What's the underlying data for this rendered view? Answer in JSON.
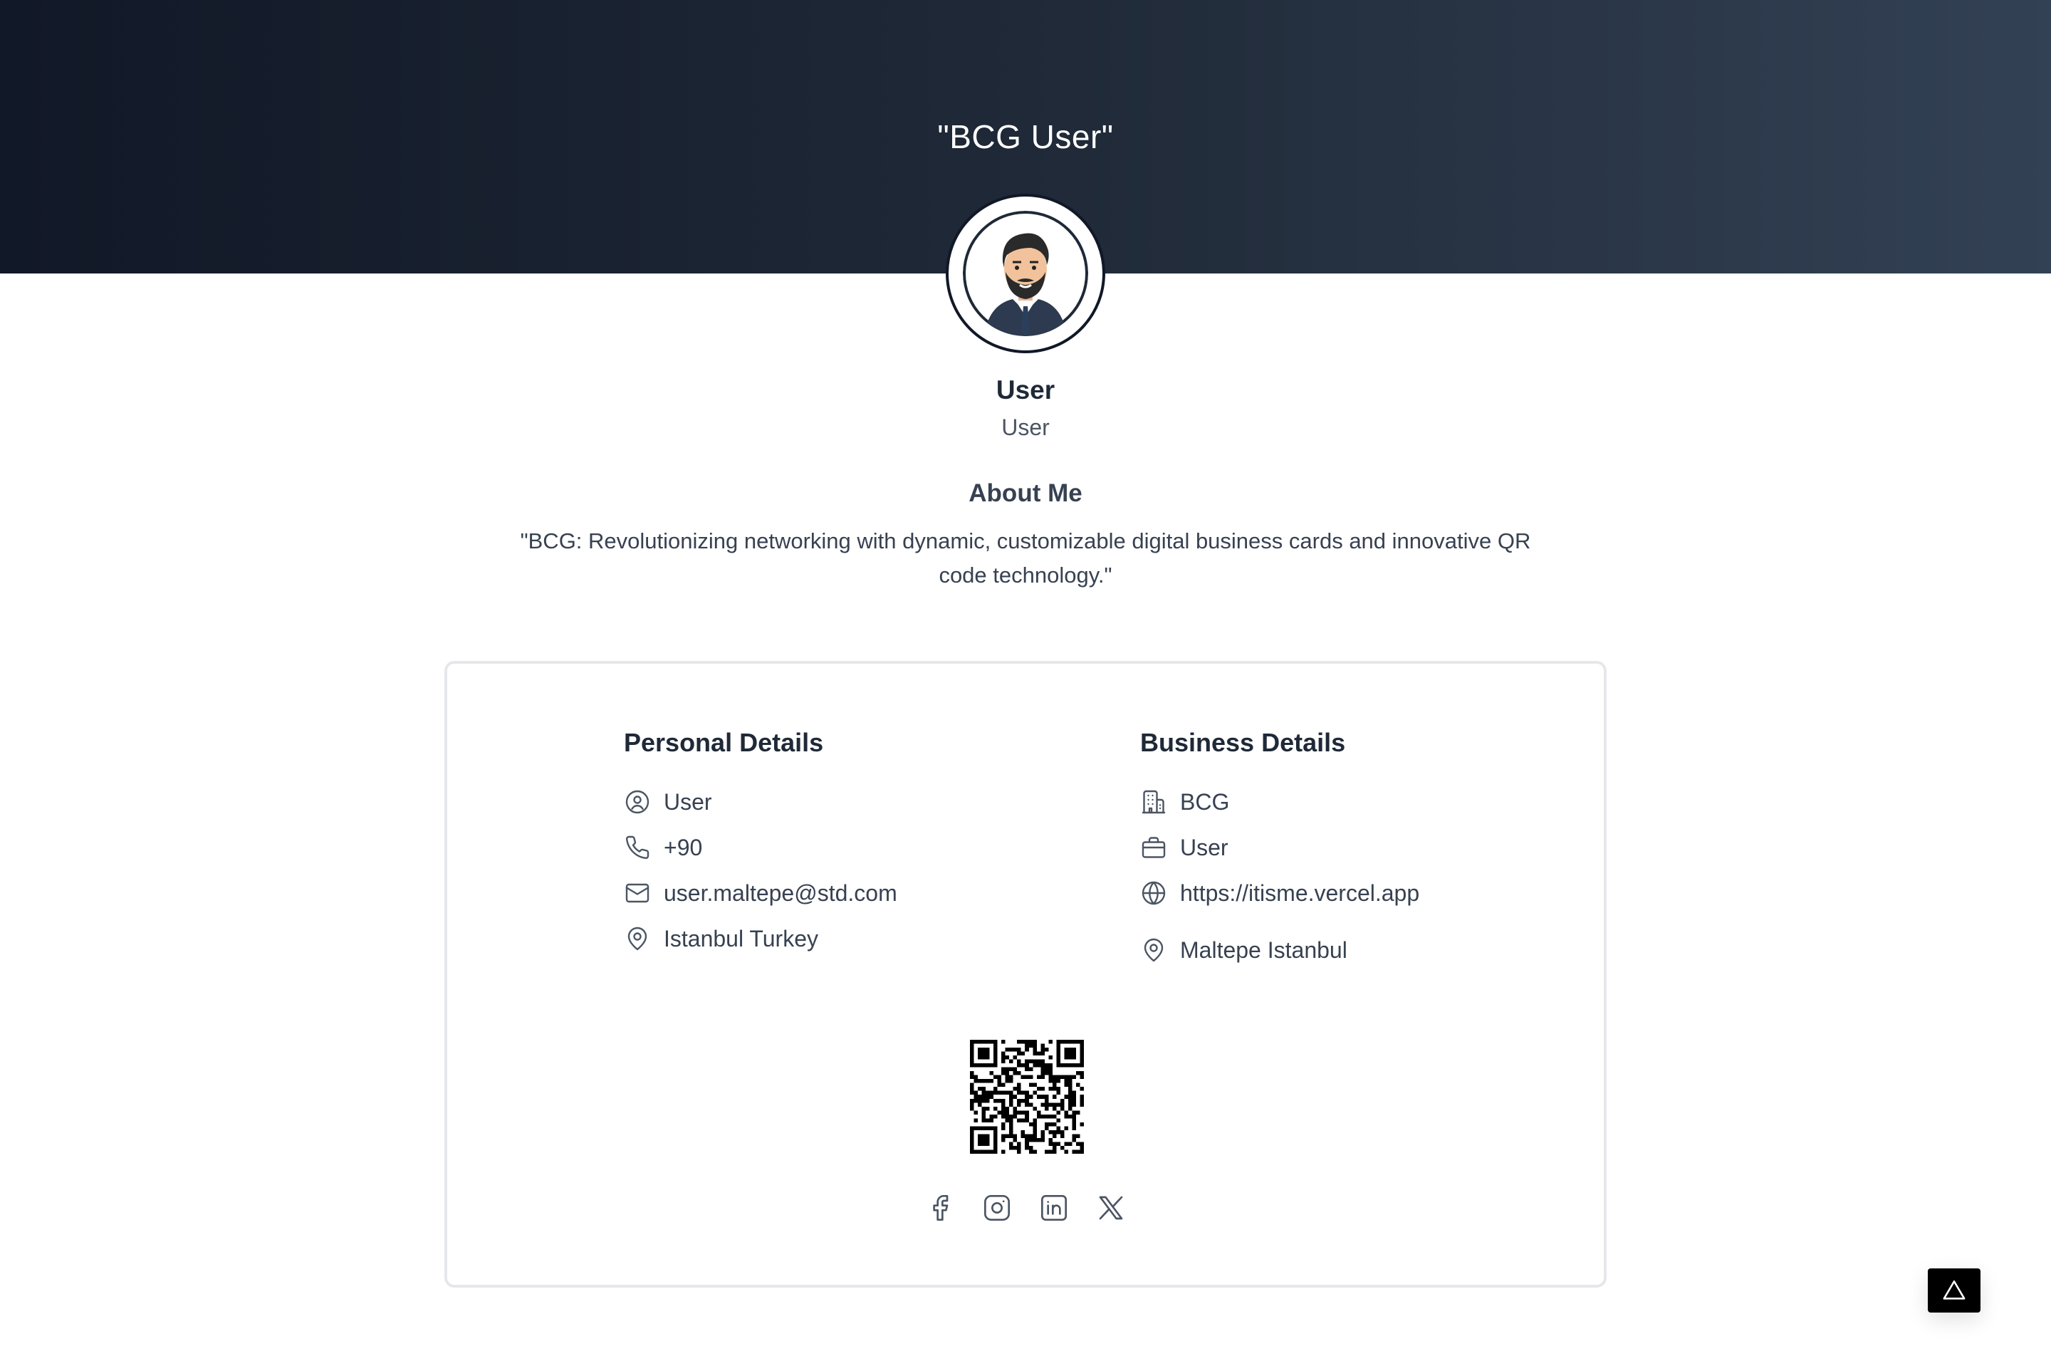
{
  "header": {
    "title": "\"BCG User\""
  },
  "profile": {
    "name": "User",
    "role": "User",
    "avatar_icon": "person-avatar-icon"
  },
  "about": {
    "title": "About Me",
    "text": "\"BCG: Revolutionizing networking with dynamic, customizable digital business cards and innovative QR code technology.\""
  },
  "personal": {
    "title": "Personal Details",
    "items": [
      {
        "icon": "user-circle-icon",
        "text": "User"
      },
      {
        "icon": "phone-icon",
        "text": "+90"
      },
      {
        "icon": "mail-icon",
        "text": "user.maltepe@std.com"
      },
      {
        "icon": "map-pin-icon",
        "text": "Istanbul Turkey"
      }
    ]
  },
  "business": {
    "title": "Business Details",
    "items": [
      {
        "icon": "building-icon",
        "text": "BCG"
      },
      {
        "icon": "briefcase-icon",
        "text": "User"
      },
      {
        "icon": "globe-icon",
        "text": "https://itisme.vercel.app"
      },
      {
        "icon": "map-pin-icon",
        "text": "Maltepe Istanbul"
      }
    ]
  },
  "qr": {
    "icon": "qr-code-icon"
  },
  "socials": [
    {
      "icon": "facebook-icon"
    },
    {
      "icon": "instagram-icon"
    },
    {
      "icon": "linkedin-icon"
    },
    {
      "icon": "x-twitter-icon"
    }
  ],
  "fab": {
    "icon": "triangle-icon"
  },
  "colors": {
    "hero_start": "#111827",
    "hero_end": "#334155",
    "text_dark": "#1f2937",
    "text_muted": "#4b5563",
    "card_border": "#e5e7eb"
  }
}
